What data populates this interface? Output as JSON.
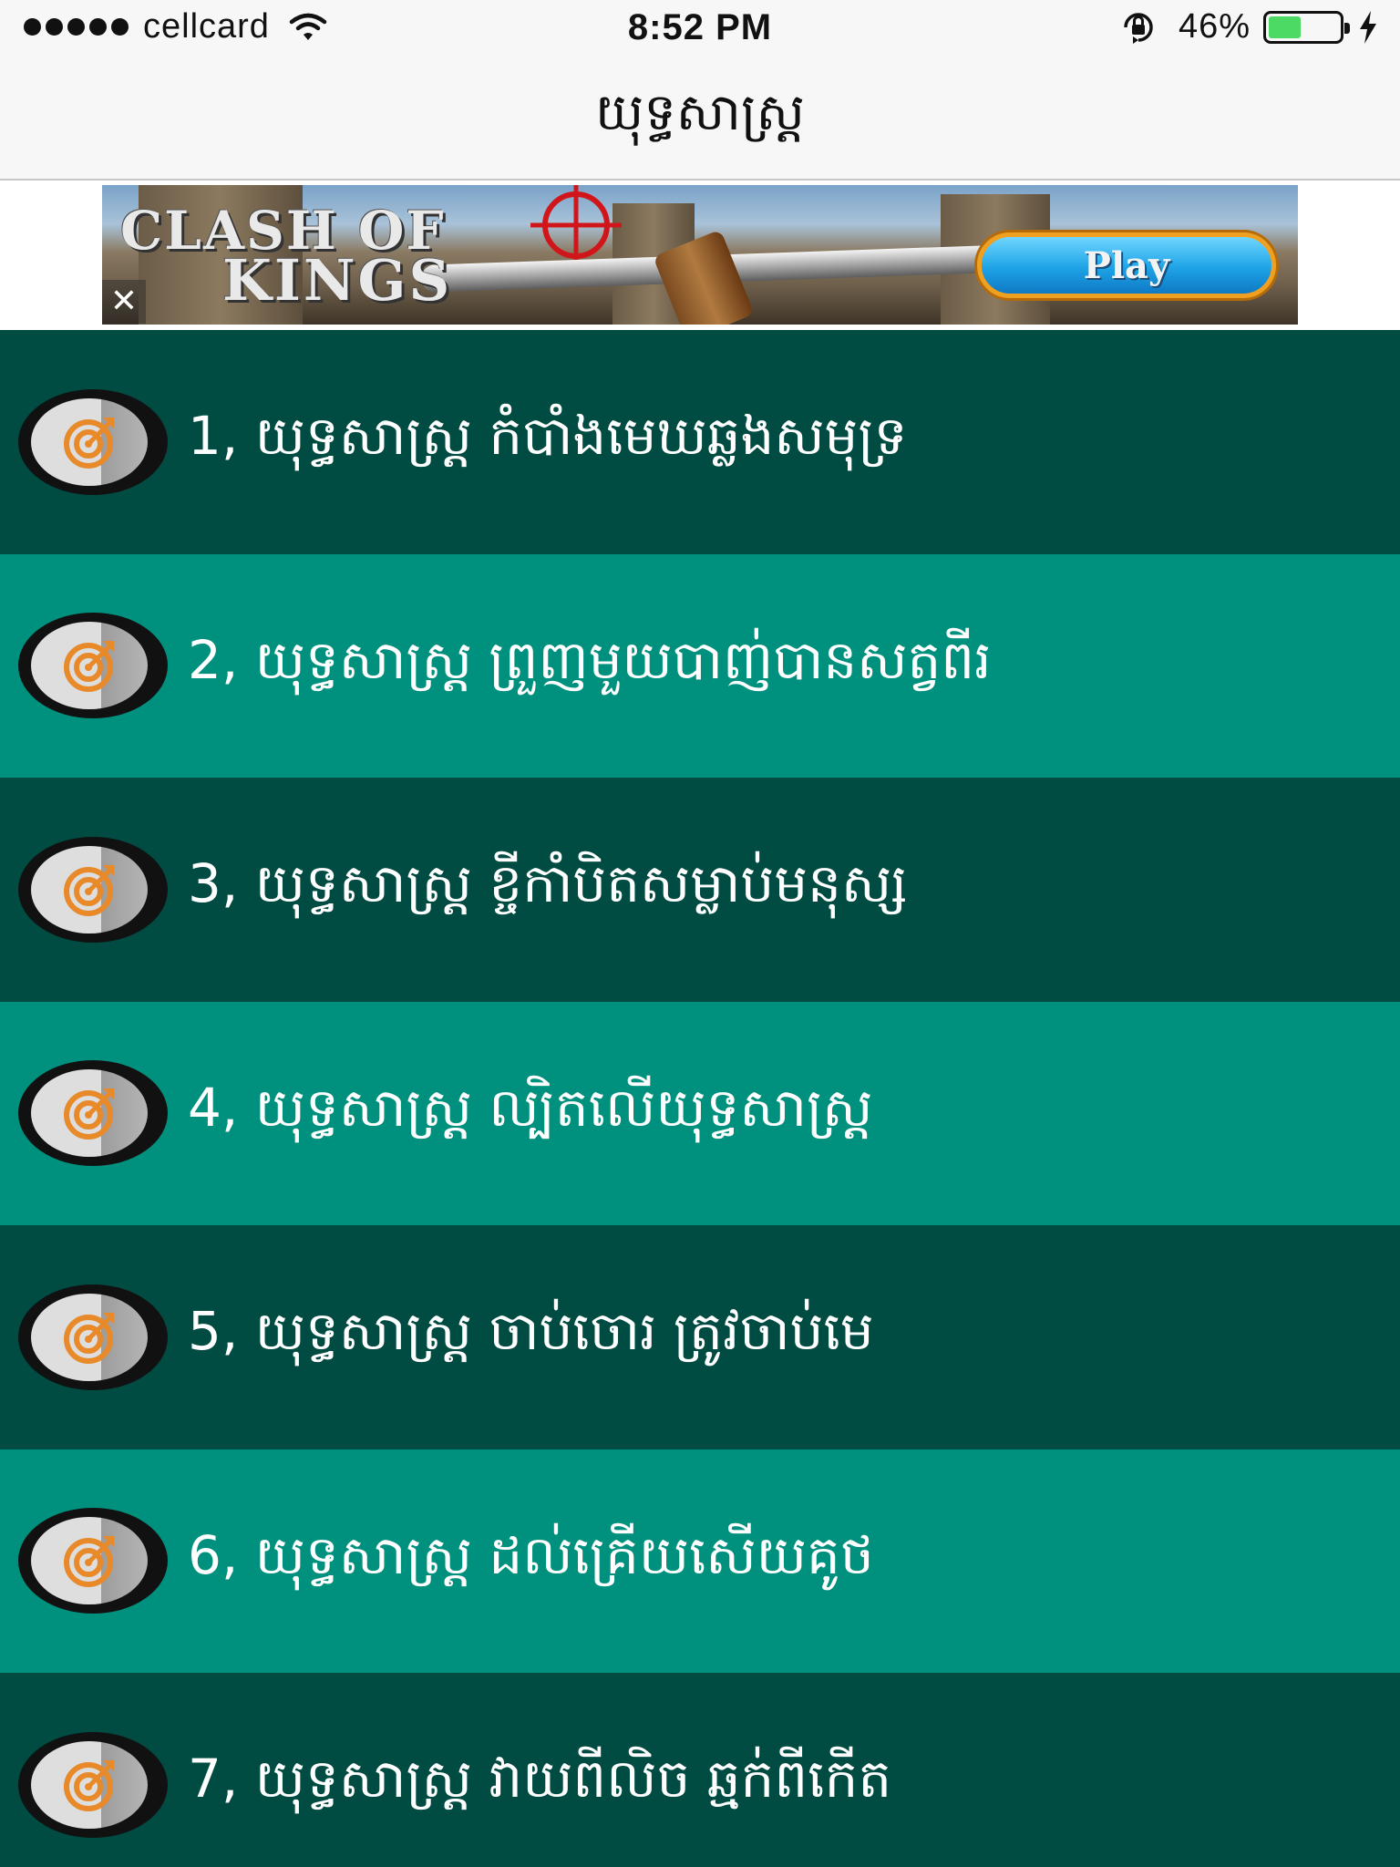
{
  "status_bar": {
    "carrier": "cellcard",
    "time": "8:52 PM",
    "battery_percent": "46%",
    "battery_level": 0.46,
    "icons": [
      "signal-dots-icon",
      "wifi-icon",
      "rotation-lock-icon",
      "battery-icon",
      "charging-bolt-icon"
    ]
  },
  "nav": {
    "title": "យុទ្ធសាស្រ្ត"
  },
  "ad": {
    "logo_line1": "CLASH OF",
    "logo_line2": "KINGS",
    "play_label": "Play",
    "close_label": "✕"
  },
  "items": [
    {
      "label": "1, យុទ្ធសាស្រ្ត កំបាំងមេឃឆ្លងសមុទ្រ",
      "icon": "target-icon"
    },
    {
      "label": "2, យុទ្ធសាស្រ្ត ព្រួញមួយបាញ់បានសត្វពីរ",
      "icon": "target-icon"
    },
    {
      "label": "3, យុទ្ធសាស្រ្ត ខ្ចីកាំបិតសម្លាប់មនុស្ស",
      "icon": "target-icon"
    },
    {
      "label": "4, យុទ្ធសាស្រ្ត ល្បិតលើយុទ្ធសាស្រ្ត",
      "icon": "target-icon"
    },
    {
      "label": "5, យុទ្ធសាស្រ្ត ចាប់ចោរ ត្រូវចាប់មេ",
      "icon": "target-icon"
    },
    {
      "label": "6, យុទ្ធសាស្រ្ត ដល់គ្រើយសើយគូថ",
      "icon": "target-icon"
    },
    {
      "label": "7, យុទ្ធសាស្រ្ត វាយពីលិច ឆ្មក់ពីកើត",
      "icon": "target-icon"
    }
  ],
  "colors": {
    "row_dark": "#004b42",
    "row_light": "#00907e",
    "icon_orange": "#e8892a",
    "battery_green": "#4cd964"
  }
}
